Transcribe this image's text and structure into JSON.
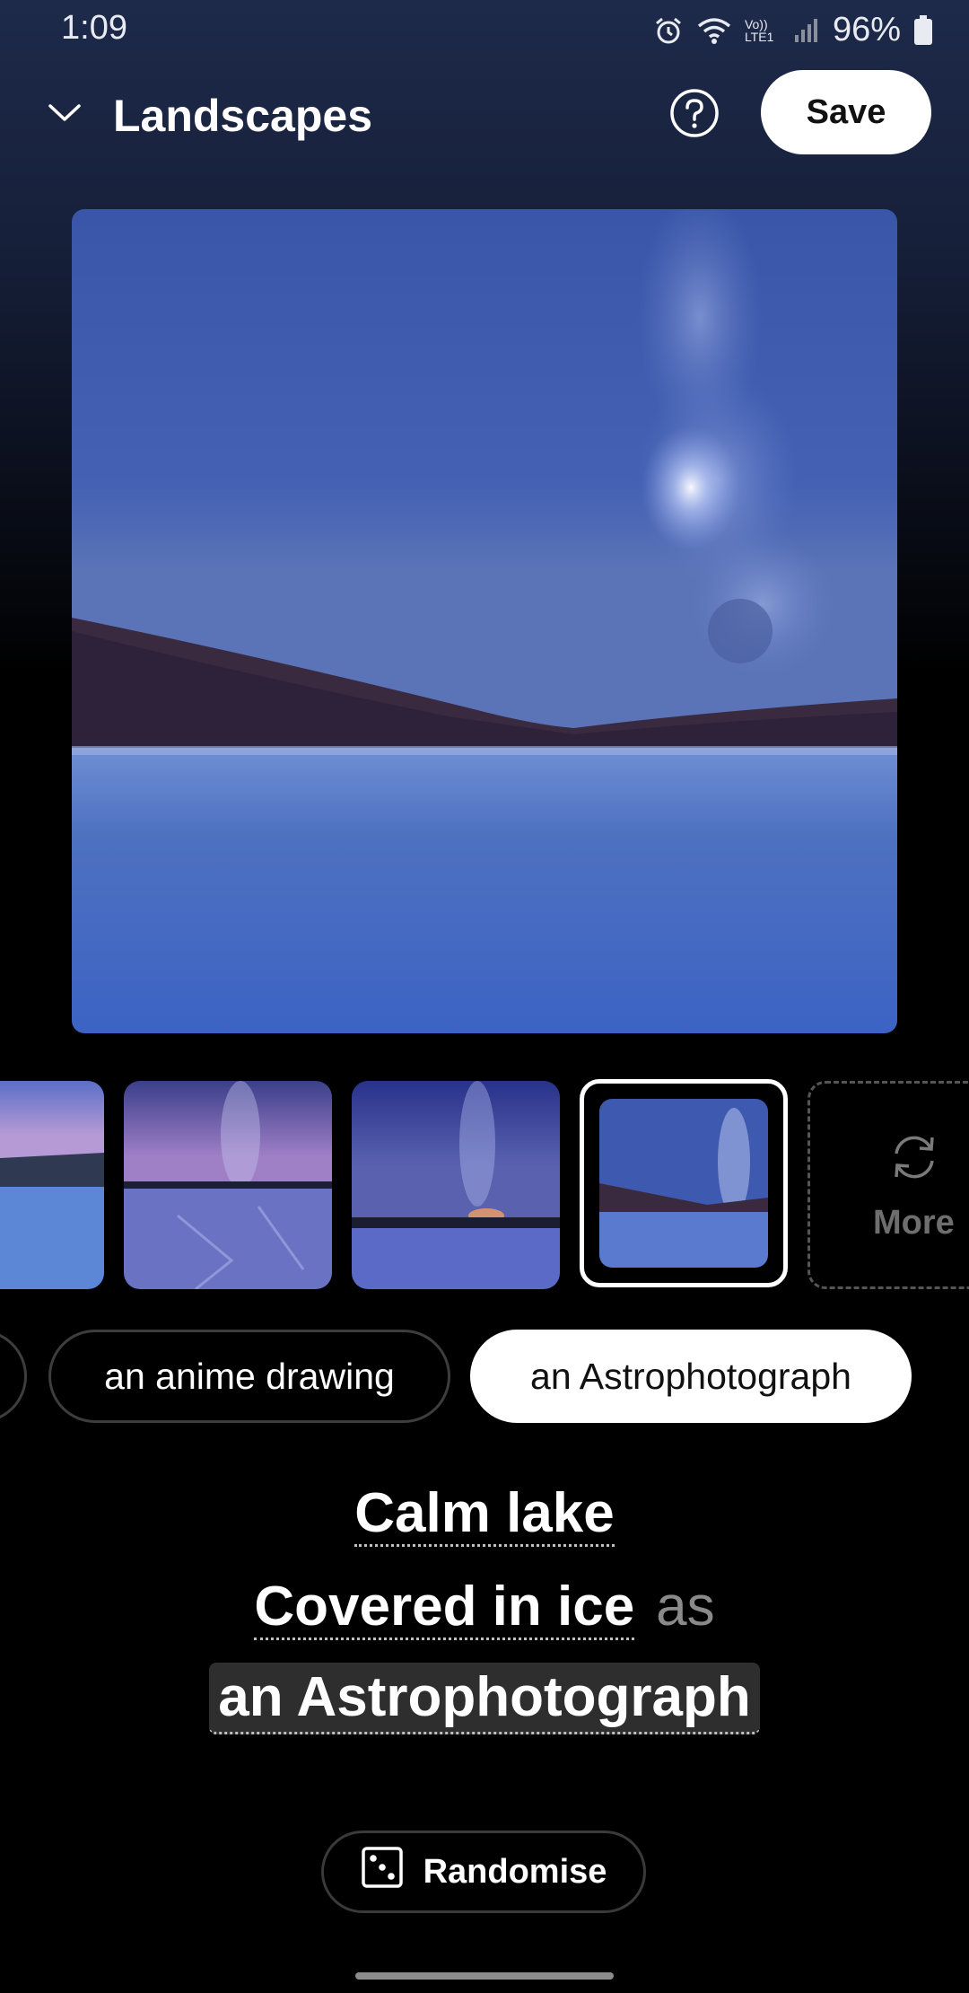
{
  "status_bar": {
    "time": "1:09",
    "network": "Vo)) LTE1",
    "battery": "96%",
    "icons": [
      "alarm-icon",
      "wifi-icon",
      "volte-icon",
      "signal-icon",
      "battery-icon"
    ]
  },
  "header": {
    "title": "Landscapes",
    "collapse_icon": "chevron-down-icon",
    "help_icon": "help-icon",
    "save_label": "Save"
  },
  "thumbnails": {
    "count_visible": 4,
    "selected_index": 3,
    "more_label": "More",
    "more_icon": "refresh-icon"
  },
  "styles": {
    "chips": [
      {
        "label": "",
        "selected": false
      },
      {
        "label": "an anime drawing",
        "selected": false
      },
      {
        "label": "an Astrophotograph",
        "selected": true
      }
    ]
  },
  "prompt": {
    "line1": "Calm lake",
    "line2": "Covered in ice",
    "connector": "as",
    "line3": "an Astrophotograph"
  },
  "randomise": {
    "label": "Randomise",
    "icon": "dice-icon"
  },
  "colors": {
    "accent": "#ffffff",
    "background": "#000000",
    "muted_text": "#8a8a8a"
  }
}
